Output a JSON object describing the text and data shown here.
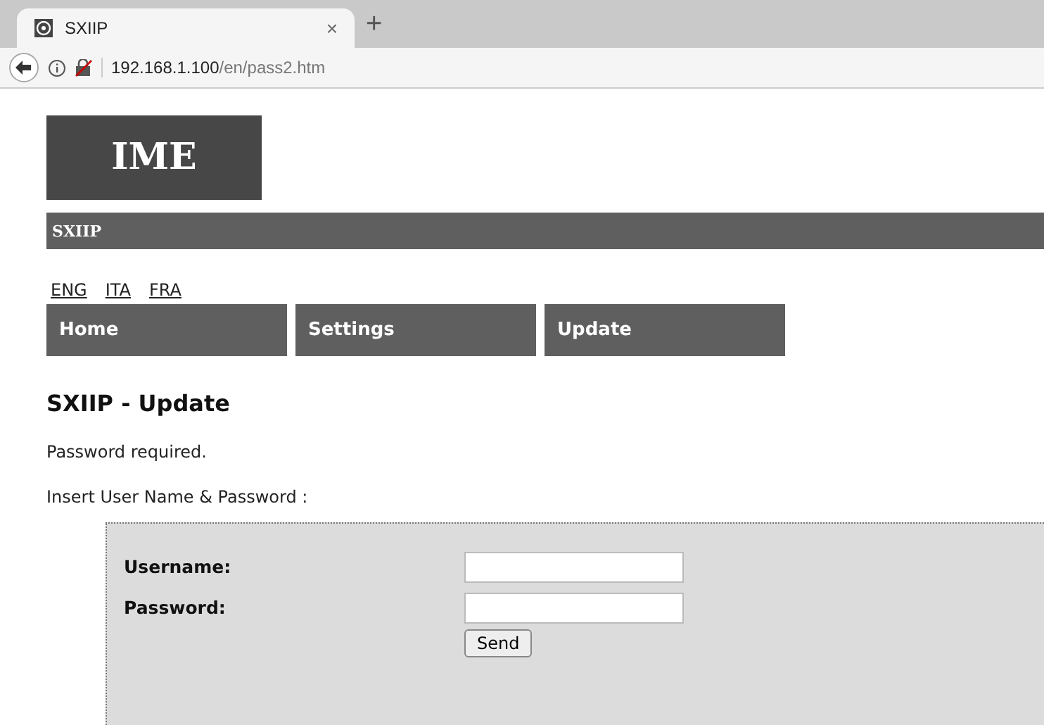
{
  "browser": {
    "tab": {
      "title": "SXIIP",
      "close": "×",
      "selected": true
    },
    "new_tab": "+",
    "url_host": "192.168.1.100",
    "url_path": "/en/pass2.htm"
  },
  "logo": "IME",
  "banner": "SXIIP",
  "languages": [
    {
      "label": "ENG"
    },
    {
      "label": "ITA"
    },
    {
      "label": "FRA"
    }
  ],
  "nav": [
    {
      "label": "Home"
    },
    {
      "label": "Settings"
    },
    {
      "label": "Update"
    }
  ],
  "heading": "SXIIP - Update",
  "messages": [
    "Password required.",
    "Insert User Name & Password :"
  ],
  "form": {
    "fields": [
      {
        "label": "Username:"
      },
      {
        "label": "Password:"
      }
    ],
    "submit": "Send"
  }
}
